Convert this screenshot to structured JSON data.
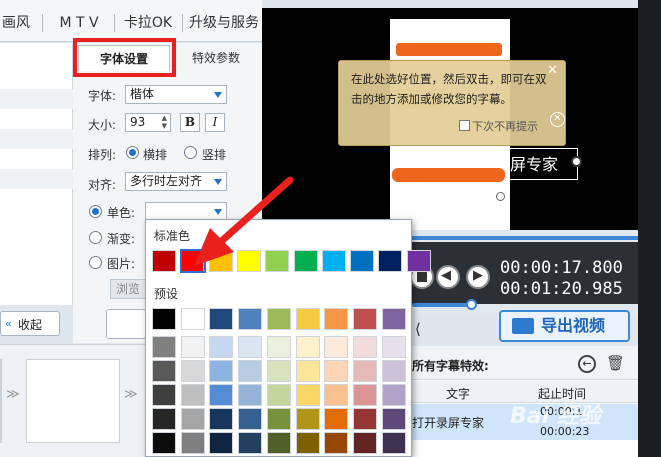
{
  "top_tabs": [
    "画风格",
    "M T V",
    "卡拉OK",
    "升级与服务"
  ],
  "font_tabs": {
    "font_settings": "字体设置",
    "effect_params": "特效参数"
  },
  "form": {
    "font_label": "字体:",
    "font_value": "楷体",
    "size_label": "大小:",
    "size_value": "93",
    "bold": "B",
    "italic": "I",
    "arrange_label": "排列:",
    "horizontal": "横排",
    "vertical": "竖排",
    "align_label": "对齐:",
    "align_value": "多行时左对齐",
    "single_color": "单色:",
    "gradient": "渐变:",
    "image": "图片:",
    "browse": "浏览"
  },
  "collapse_button": "收起",
  "tooltip": {
    "text": "在此处选好位置，然后双击，即可在双击的地方添加或修改您的字幕。",
    "dont_show": "下次不再提示"
  },
  "caption_preview": "屏专家",
  "time_current": "00:00:17.800",
  "time_total": "00:01:20.985",
  "export_button": "导出视频",
  "subtitles_panel": {
    "title": "所有字幕特效:",
    "col_text": "文字",
    "col_start": "起止时间",
    "row_text": "打开录屏专家",
    "row_start": "00:00:1",
    "row_end": "00:00:23"
  },
  "color_popup": {
    "standard_title": "标准色",
    "preset_title": "预设",
    "standard_colors": [
      "#c00000",
      "#ff0000",
      "#ffc000",
      "#ffff00",
      "#92d050",
      "#00b050",
      "#00b0f0",
      "#0070c0",
      "#002060",
      "#7030a0"
    ],
    "preset_top": [
      "#000000",
      "#ffffff",
      "#1f497d",
      "#4f81bd",
      "#9bbb59",
      "#f8cb3e",
      "#f79646",
      "#c0504d",
      "#8064a2"
    ],
    "preset_columns": [
      [
        "#7f7f7f",
        "#595959",
        "#3f3f3f",
        "#262626",
        "#0c0c0c"
      ],
      [
        "#f2f2f2",
        "#d8d8d8",
        "#bfbfbf",
        "#a5a5a5",
        "#7f7f7f"
      ],
      [
        "#c6d9f0",
        "#8db3e2",
        "#548dd4",
        "#17365d",
        "#0f243e"
      ],
      [
        "#dbe5f1",
        "#b8cce4",
        "#95b3d7",
        "#366092",
        "#244061"
      ],
      [
        "#ebf1dd",
        "#d7e3bc",
        "#c3d69b",
        "#76923c",
        "#4f6128"
      ],
      [
        "#fef2cc",
        "#fde59a",
        "#fcd767",
        "#b29417",
        "#7f6000"
      ],
      [
        "#fdeada",
        "#fbd5b5",
        "#fac08f",
        "#e36c09",
        "#974806"
      ],
      [
        "#f2dcdb",
        "#e5b9b7",
        "#d99694",
        "#953734",
        "#632423"
      ],
      [
        "#e5e0ec",
        "#ccc1d9",
        "#b2a2c7",
        "#5f497a",
        "#3f3151"
      ]
    ]
  }
}
